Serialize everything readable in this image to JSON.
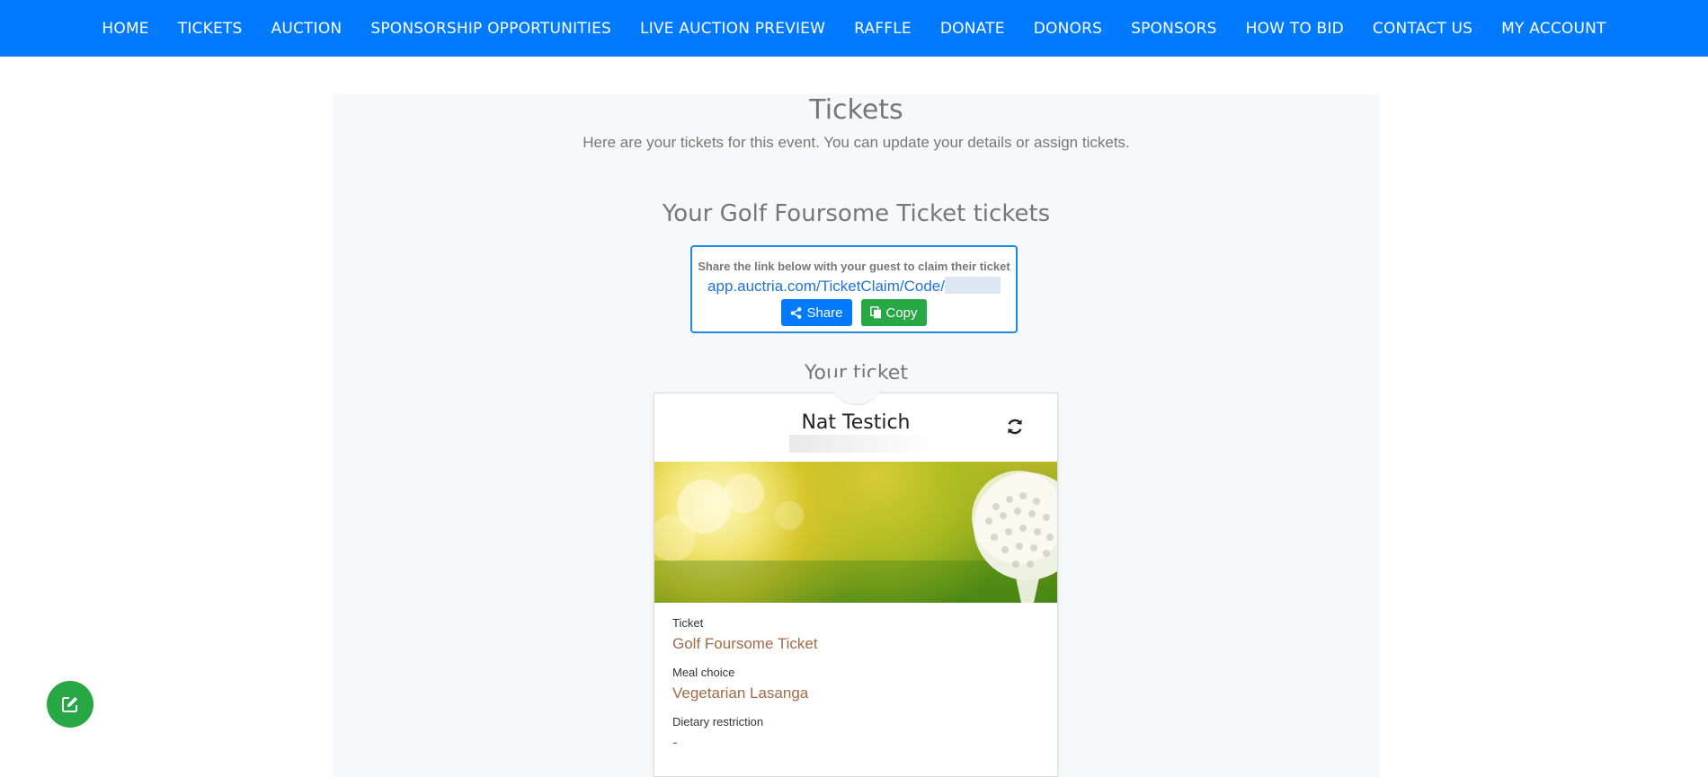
{
  "nav": {
    "items": [
      "HOME",
      "TICKETS",
      "AUCTION",
      "SPONSORSHIP OPPORTUNITIES",
      "LIVE AUCTION PREVIEW",
      "RAFFLE",
      "DONATE",
      "DONORS",
      "SPONSORS",
      "HOW TO BID",
      "CONTACT US",
      "MY ACCOUNT"
    ]
  },
  "page": {
    "title": "Tickets",
    "subtitle": "Here are your tickets for this event. You can update your details or assign tickets."
  },
  "tickets_section": {
    "title": "Your Golf Foursome Ticket tickets",
    "share_hint": "Share the link below with your guest to claim their ticket",
    "share_link": "app.auctria.com/TicketClaim/Code/",
    "share_label": "Share",
    "copy_label": "Copy"
  },
  "ticket": {
    "heading": "Your ticket",
    "holder_name": "Nat Testich",
    "fields": [
      {
        "label": "Ticket",
        "value": "Golf Foursome Ticket"
      },
      {
        "label": "Meal choice",
        "value": "Vegetarian Lasanga"
      },
      {
        "label": "Dietary restriction",
        "value": "-"
      }
    ]
  },
  "colors": {
    "nav_bg": "#007bff",
    "share_button": "#007bff",
    "copy_button": "#28a745",
    "field_value": "#a26a47",
    "fab": "#28a745"
  },
  "icons": {
    "share": "share-icon",
    "copy": "copy-icon",
    "refresh": "refresh-icon",
    "edit": "edit-icon"
  }
}
